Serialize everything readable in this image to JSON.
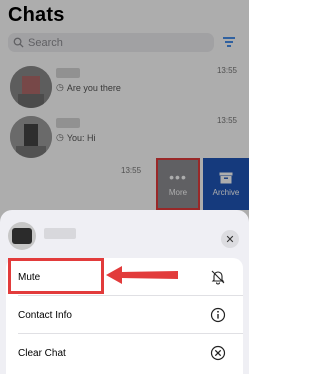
{
  "header": {
    "title": "Chats"
  },
  "search": {
    "placeholder": "Search"
  },
  "chats": [
    {
      "preview": "Are you there",
      "time": "13:55"
    },
    {
      "preview": "You: Hi",
      "time": "13:55"
    },
    {
      "time": "13:55"
    }
  ],
  "swipe_actions": {
    "more_label": "More",
    "archive_label": "Archive"
  },
  "sheet": {
    "options": [
      {
        "label": "Mute",
        "icon": "muted-bell-icon"
      },
      {
        "label": "Contact Info",
        "icon": "info-icon"
      },
      {
        "label": "Clear Chat",
        "icon": "clear-circle-icon"
      }
    ]
  },
  "colors": {
    "highlight": "#e23b3b",
    "archive": "#1f56b8",
    "accent": "#1a73e8"
  }
}
